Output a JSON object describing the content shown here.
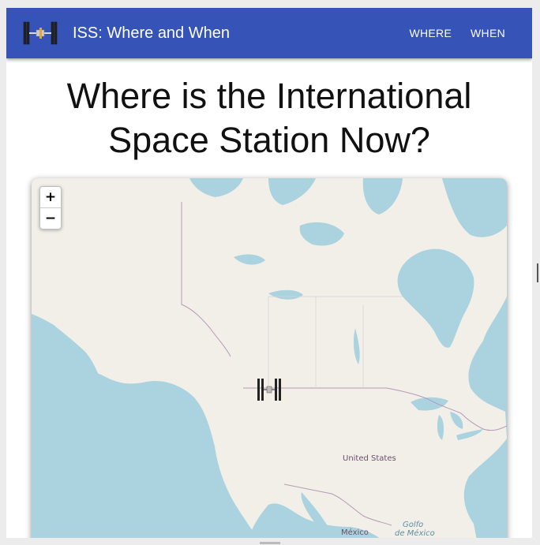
{
  "app": {
    "title": "ISS: Where and When",
    "nav": [
      "WHERE",
      "WHEN"
    ]
  },
  "page": {
    "heading_line1": "Where is the International",
    "heading_line2": "Space Station Now?"
  },
  "map": {
    "zoom_in": "+",
    "zoom_out": "−",
    "labels": {
      "usa": "United States",
      "mexico": "México",
      "gulf_line1": "Golfo",
      "gulf_line2": "de México"
    },
    "colors": {
      "water": "#aad3df",
      "land": "#f2efe9",
      "border": "#b59ab6"
    }
  },
  "colors": {
    "appbar": "#3653b8"
  },
  "icons": {
    "logo": "iss-logo-icon",
    "marker": "iss-marker-icon"
  }
}
